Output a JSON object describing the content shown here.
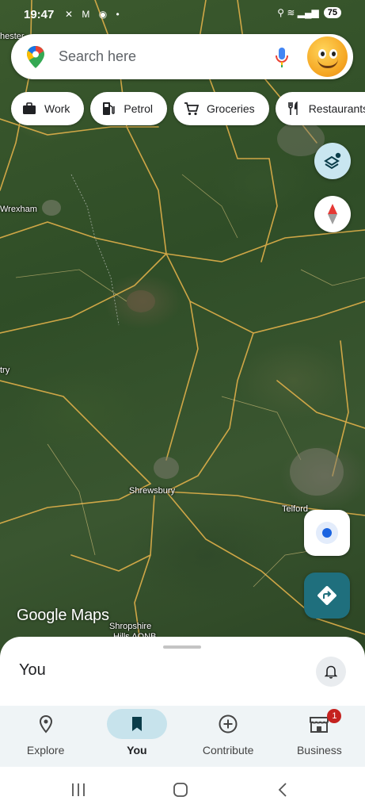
{
  "status_bar": {
    "time": "19:47",
    "left_icons": "✕ M ◉ •",
    "right_icons": "⚲ ≋ ▂▄▆",
    "battery": "75"
  },
  "search": {
    "placeholder": "Search here"
  },
  "chips": [
    {
      "label": "Work",
      "icon": "briefcase-icon"
    },
    {
      "label": "Petrol",
      "icon": "fuel-pump-icon"
    },
    {
      "label": "Groceries",
      "icon": "shopping-cart-icon"
    },
    {
      "label": "Restaurants",
      "icon": "fork-knife-icon"
    }
  ],
  "map": {
    "places": {
      "wrexham": "Wrexham",
      "shrewsbury": "Shrewsbury",
      "telford": "Telford",
      "shropshire": "Shropshire",
      "hills": "Hills AONB",
      "chester": "hester",
      "oswestry": "try"
    },
    "logo": "Google Maps"
  },
  "sheet": {
    "title": "You"
  },
  "bottom_nav": {
    "items": [
      {
        "label": "Explore",
        "icon": "location-pin-icon",
        "active": false
      },
      {
        "label": "You",
        "icon": "bookmark-icon",
        "active": true
      },
      {
        "label": "Contribute",
        "icon": "add-circle-icon",
        "active": false
      },
      {
        "label": "Business",
        "icon": "storefront-icon",
        "active": false,
        "badge": "1"
      }
    ]
  },
  "colors": {
    "accent": "#1a73e8",
    "active_pill": "#c7e3ec",
    "directions": "#1f6f7d",
    "road": "#e8b84a"
  }
}
